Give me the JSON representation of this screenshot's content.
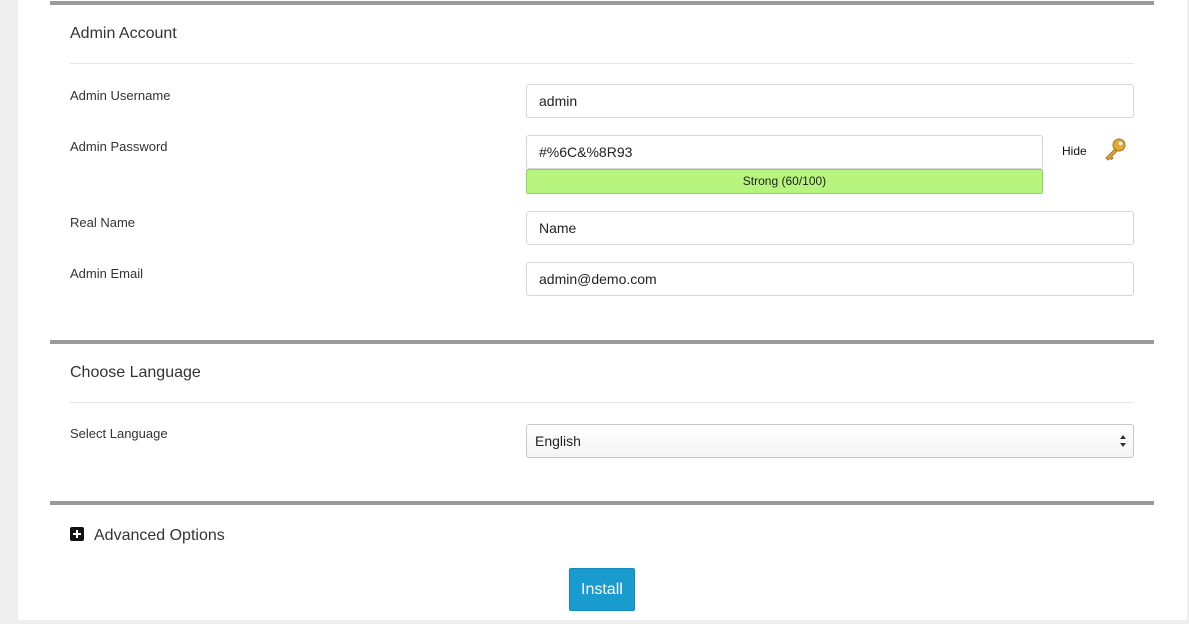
{
  "admin_account": {
    "title": "Admin Account",
    "username": {
      "label": "Admin Username",
      "value": "admin"
    },
    "password": {
      "label": "Admin Password",
      "value": "#%6C&%8R93",
      "strength_text": "Strong (60/100)",
      "strength_score": 60,
      "strength_color": "#b7f47d",
      "hide_label": "Hide",
      "generate_icon": "key-icon"
    },
    "real_name": {
      "label": "Real Name",
      "value": "Name"
    },
    "email": {
      "label": "Admin Email",
      "value": "admin@demo.com"
    }
  },
  "language": {
    "title": "Choose Language",
    "select_label": "Select Language",
    "selected": "English"
  },
  "advanced": {
    "toggle_icon": "plus-square-icon",
    "label": "Advanced Options"
  },
  "install_button": {
    "label": "Install",
    "color": "#1a9bd0"
  }
}
